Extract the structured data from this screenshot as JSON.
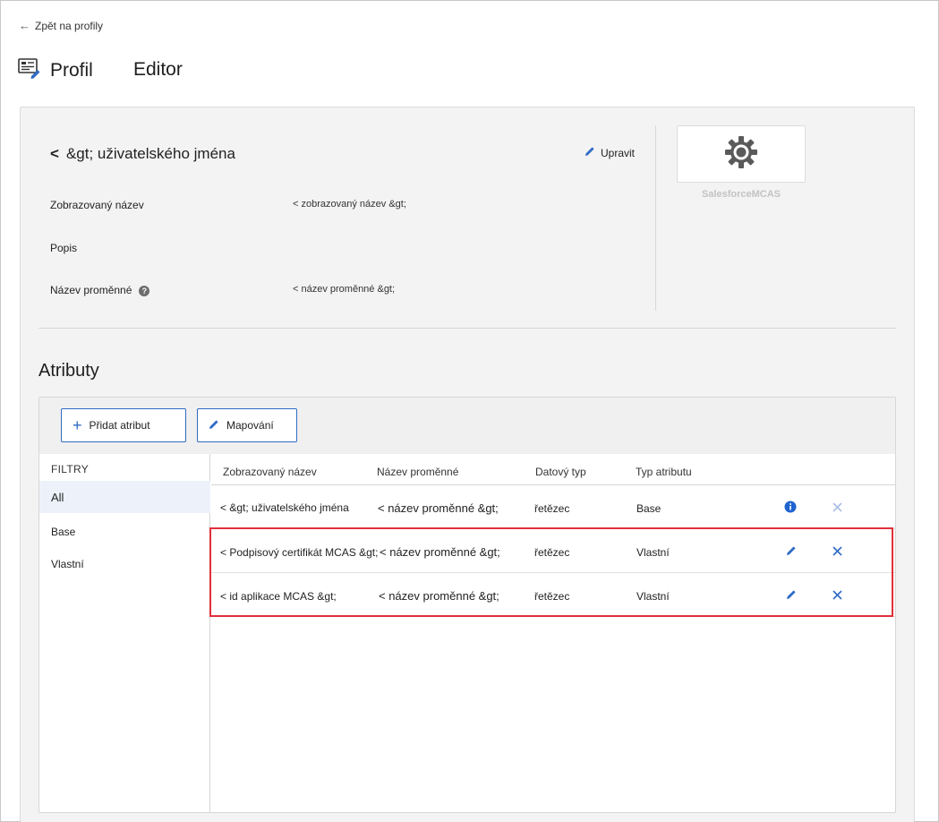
{
  "nav": {
    "back_label": "Zpět na profily"
  },
  "header": {
    "title_part1": "Profil",
    "title_part2": "Editor"
  },
  "profile": {
    "name_prefix": "<",
    "name": "&gt; uživatelského jména",
    "edit_label": "Upravit",
    "fields": [
      {
        "label": "Zobrazovaný název",
        "value": "< zobrazovaný název &gt;"
      },
      {
        "label": "Popis",
        "value": ""
      },
      {
        "label": "Název proměnné",
        "value": "< název proměnné &gt;"
      }
    ],
    "logo_caption": "SalesforceMCAS"
  },
  "attributes": {
    "title": "Atributy",
    "add_button": "Přidat atribut",
    "mapping_button": "Mapování",
    "filters_heading": "FILTRY",
    "filters": [
      "All",
      "Base",
      "Vlastní"
    ],
    "columns": [
      "Zobrazovaný název",
      "Název proměnné",
      "Datový typ",
      "Typ atributu"
    ],
    "rows": [
      {
        "display_prefix": "<",
        "display": "&gt; uživatelského jména",
        "variable": "< název proměnné &gt;",
        "data_type": "řetězec",
        "attr_type": "Base",
        "action1": "info-icon",
        "action2": "close-icon"
      },
      {
        "display_prefix": "<",
        "display": "Podpisový certifikát MCAS &gt;",
        "variable": "< název proměnné &gt;",
        "data_type": "řetězec",
        "attr_type": "Vlastní",
        "action1": "pencil-icon",
        "action2": "close-icon"
      },
      {
        "display_prefix": "<",
        "display": "id aplikace MCAS &gt;",
        "variable": "< název proměnné &gt;",
        "data_type": "řetězec",
        "attr_type": "Vlastní",
        "action1": "pencil-icon",
        "action2": "close-icon"
      }
    ]
  },
  "colors": {
    "accent": "#2f6bc5",
    "highlight_border": "#e0303a",
    "panel_bg": "#f3f3f3",
    "disabled_icon": "#a9bfe3"
  }
}
